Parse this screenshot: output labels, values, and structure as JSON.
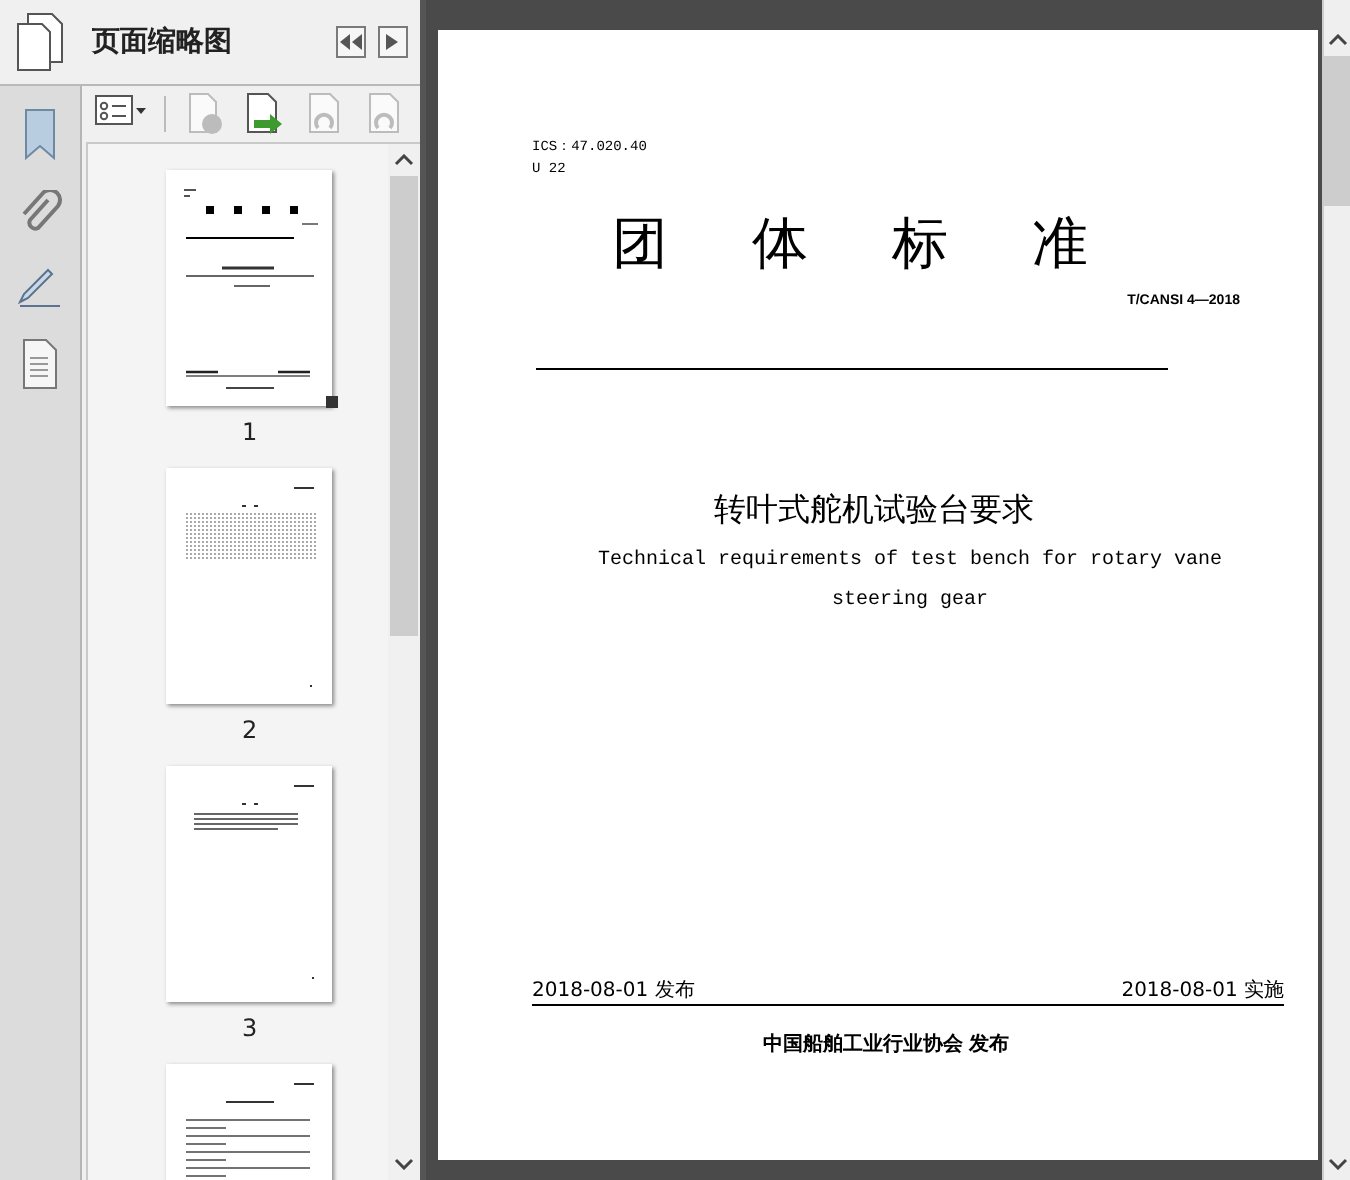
{
  "thumbnails_panel": {
    "title": "页面缩略图",
    "toolbar": [
      {
        "kind": "options",
        "disabled": false
      },
      {
        "kind": "delete",
        "disabled": true
      },
      {
        "kind": "insert",
        "disabled": false
      },
      {
        "kind": "undo",
        "disabled": true
      },
      {
        "kind": "redo",
        "disabled": true
      }
    ],
    "thumbnails": [
      {
        "label": "1",
        "selected": true,
        "kind": "cover"
      },
      {
        "label": "2",
        "selected": false,
        "kind": "contents"
      },
      {
        "label": "3",
        "selected": false,
        "kind": "foreword"
      },
      {
        "selected": false,
        "kind": "body"
      }
    ]
  },
  "document": {
    "ics": "ICS：47.020.40",
    "ccs": "U 22",
    "heading": "团体标准",
    "code": "T/CANSI 4—2018",
    "title_zh": "转叶式舵机试验台要求",
    "title_en": "Technical requirements of test bench for rotary vane steering gear",
    "issue_date": "2018-08-01 发布",
    "effective_date": "2018-08-01 实施",
    "publisher": "中国船舶工业行业协会  发布"
  }
}
